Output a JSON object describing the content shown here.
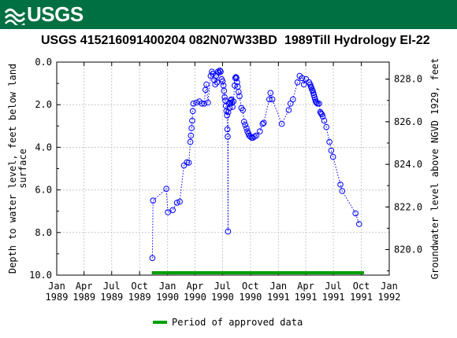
{
  "header": {
    "agency": "USGS"
  },
  "title": {
    "site": "USGS 415216091400204 082N07W33BD",
    "description": "1989Till Hydrology El-22"
  },
  "legend": {
    "label": "Period of approved data",
    "color": "#00a000"
  },
  "colors": {
    "banner": "#006f41",
    "points": "#0000ff",
    "approved": "#00a000"
  },
  "chart_data": {
    "type": "scatter",
    "ylabel_left": "Depth to water level, feet below land\nsurface",
    "ylabel_right": "Groundwater level above NGVD 1929, feet",
    "y_inverted": true,
    "ylim_left": [
      10.0,
      0.0
    ],
    "yticks_left": [
      "0.0",
      "2.0",
      "4.0",
      "6.0",
      "8.0",
      "10.0"
    ],
    "ylim_right": [
      818.8,
      828.8
    ],
    "yticks_right": [
      "820.0",
      "822.0",
      "824.0",
      "826.0",
      "828.0"
    ],
    "xlim": [
      "1989-01-01",
      "1992-01-01"
    ],
    "xticks": [
      {
        "month": "Jan",
        "year": "1989",
        "date": "1989-01-01"
      },
      {
        "month": "Apr",
        "year": "1989",
        "date": "1989-04-01"
      },
      {
        "month": "Jul",
        "year": "1989",
        "date": "1989-07-01"
      },
      {
        "month": "Oct",
        "year": "1989",
        "date": "1989-10-01"
      },
      {
        "month": "Jan",
        "year": "1990",
        "date": "1990-01-01"
      },
      {
        "month": "Apr",
        "year": "1990",
        "date": "1990-04-01"
      },
      {
        "month": "Jul",
        "year": "1990",
        "date": "1990-07-01"
      },
      {
        "month": "Oct",
        "year": "1990",
        "date": "1990-10-01"
      },
      {
        "month": "Jan",
        "year": "1991",
        "date": "1991-01-01"
      },
      {
        "month": "Apr",
        "year": "1991",
        "date": "1991-04-01"
      },
      {
        "month": "Jul",
        "year": "1991",
        "date": "1991-07-01"
      },
      {
        "month": "Oct",
        "year": "1991",
        "date": "1991-10-01"
      },
      {
        "month": "Jan",
        "year": "1992",
        "date": "1992-01-01"
      }
    ],
    "grid": true,
    "approved_period": [
      "1989-11-10",
      "1991-10-10"
    ],
    "series": [
      {
        "marker": "circle",
        "line": "dotted",
        "points": [
          [
            "1989-11-12",
            9.2
          ],
          [
            "1989-11-14",
            6.5
          ],
          [
            "1989-12-28",
            5.95
          ],
          [
            "1990-01-02",
            7.05
          ],
          [
            "1990-01-18",
            6.95
          ],
          [
            "1990-02-01",
            6.6
          ],
          [
            "1990-02-10",
            6.55
          ],
          [
            "1990-02-24",
            4.85
          ],
          [
            "1990-03-06",
            4.7
          ],
          [
            "1990-03-12",
            4.72
          ],
          [
            "1990-03-17",
            3.75
          ],
          [
            "1990-03-19",
            3.45
          ],
          [
            "1990-03-21",
            3.1
          ],
          [
            "1990-03-23",
            2.75
          ],
          [
            "1990-03-25",
            2.3
          ],
          [
            "1990-03-27",
            1.95
          ],
          [
            "1990-04-06",
            1.9
          ],
          [
            "1990-04-16",
            1.85
          ],
          [
            "1990-04-24",
            1.95
          ],
          [
            "1990-05-02",
            1.95
          ],
          [
            "1990-05-06",
            1.3
          ],
          [
            "1990-05-09",
            1.05
          ],
          [
            "1990-05-14",
            1.9
          ],
          [
            "1990-05-23",
            0.65
          ],
          [
            "1990-05-27",
            0.45
          ],
          [
            "1990-05-30",
            0.55
          ],
          [
            "1990-06-04",
            0.85
          ],
          [
            "1990-06-07",
            1.05
          ],
          [
            "1990-06-10",
            0.65
          ],
          [
            "1990-06-13",
            0.95
          ],
          [
            "1990-06-16",
            0.45
          ],
          [
            "1990-06-19",
            0.5
          ],
          [
            "1990-06-22",
            0.4
          ],
          [
            "1990-06-25",
            0.45
          ],
          [
            "1990-06-28",
            0.8
          ],
          [
            "1990-07-01",
            0.9
          ],
          [
            "1990-07-04",
            1.1
          ],
          [
            "1990-07-06",
            1.35
          ],
          [
            "1990-07-08",
            1.65
          ],
          [
            "1990-07-10",
            1.8
          ],
          [
            "1990-07-12",
            2.05
          ],
          [
            "1990-07-14",
            2.3
          ],
          [
            "1990-07-16",
            2.5
          ],
          [
            "1990-07-17",
            3.15
          ],
          [
            "1990-07-18",
            3.5
          ],
          [
            "1990-07-19",
            7.95
          ],
          [
            "1990-07-20",
            2.35
          ],
          [
            "1990-07-22",
            1.95
          ],
          [
            "1990-07-24",
            2.15
          ],
          [
            "1990-07-26",
            1.9
          ],
          [
            "1990-07-28",
            1.8
          ],
          [
            "1990-07-30",
            1.75
          ],
          [
            "1990-08-01",
            1.9
          ],
          [
            "1990-08-03",
            2.1
          ],
          [
            "1990-08-06",
            1.85
          ],
          [
            "1990-08-10",
            1.1
          ],
          [
            "1990-08-12",
            0.75
          ],
          [
            "1990-08-14",
            0.7
          ],
          [
            "1990-08-16",
            0.75
          ],
          [
            "1990-08-18",
            0.95
          ],
          [
            "1990-08-20",
            1.15
          ],
          [
            "1990-08-23",
            1.4
          ],
          [
            "1990-08-26",
            1.6
          ],
          [
            "1990-09-01",
            2.15
          ],
          [
            "1990-09-06",
            2.25
          ],
          [
            "1990-09-10",
            2.8
          ],
          [
            "1990-09-14",
            2.95
          ],
          [
            "1990-09-18",
            3.1
          ],
          [
            "1990-09-21",
            3.25
          ],
          [
            "1990-09-24",
            3.35
          ],
          [
            "1990-09-27",
            3.45
          ],
          [
            "1990-10-01",
            3.5
          ],
          [
            "1990-10-05",
            3.55
          ],
          [
            "1990-10-09",
            3.55
          ],
          [
            "1990-10-14",
            3.5
          ],
          [
            "1990-10-20",
            3.45
          ],
          [
            "1990-11-01",
            3.25
          ],
          [
            "1990-11-10",
            2.9
          ],
          [
            "1990-11-14",
            2.85
          ],
          [
            "1990-12-02",
            1.75
          ],
          [
            "1990-12-06",
            1.45
          ],
          [
            "1990-12-12",
            1.75
          ],
          [
            "1991-01-12",
            2.9
          ],
          [
            "1991-02-04",
            2.25
          ],
          [
            "1991-02-10",
            1.95
          ],
          [
            "1991-02-18",
            1.75
          ],
          [
            "1991-03-05",
            0.95
          ],
          [
            "1991-03-12",
            0.65
          ],
          [
            "1991-03-20",
            0.75
          ],
          [
            "1991-03-26",
            1.05
          ],
          [
            "1991-04-02",
            0.8
          ],
          [
            "1991-04-12",
            0.95
          ],
          [
            "1991-04-16",
            1.05
          ],
          [
            "1991-04-18",
            1.15
          ],
          [
            "1991-04-20",
            1.2
          ],
          [
            "1991-04-22",
            1.3
          ],
          [
            "1991-04-24",
            1.35
          ],
          [
            "1991-04-26",
            1.45
          ],
          [
            "1991-04-28",
            1.55
          ],
          [
            "1991-04-30",
            1.65
          ],
          [
            "1991-05-02",
            1.75
          ],
          [
            "1991-05-04",
            1.85
          ],
          [
            "1991-05-06",
            1.9
          ],
          [
            "1991-05-10",
            1.95
          ],
          [
            "1991-05-15",
            1.95
          ],
          [
            "1991-05-19",
            2.35
          ],
          [
            "1991-05-21",
            2.4
          ],
          [
            "1991-05-24",
            2.45
          ],
          [
            "1991-05-27",
            2.55
          ],
          [
            "1991-06-01",
            2.75
          ],
          [
            "1991-06-08",
            3.05
          ],
          [
            "1991-06-18",
            3.75
          ],
          [
            "1991-06-24",
            4.15
          ],
          [
            "1991-06-30",
            4.45
          ],
          [
            "1991-07-24",
            5.75
          ],
          [
            "1991-07-30",
            6.05
          ],
          [
            "1991-09-12",
            7.1
          ],
          [
            "1991-09-24",
            7.6
          ]
        ]
      }
    ]
  }
}
